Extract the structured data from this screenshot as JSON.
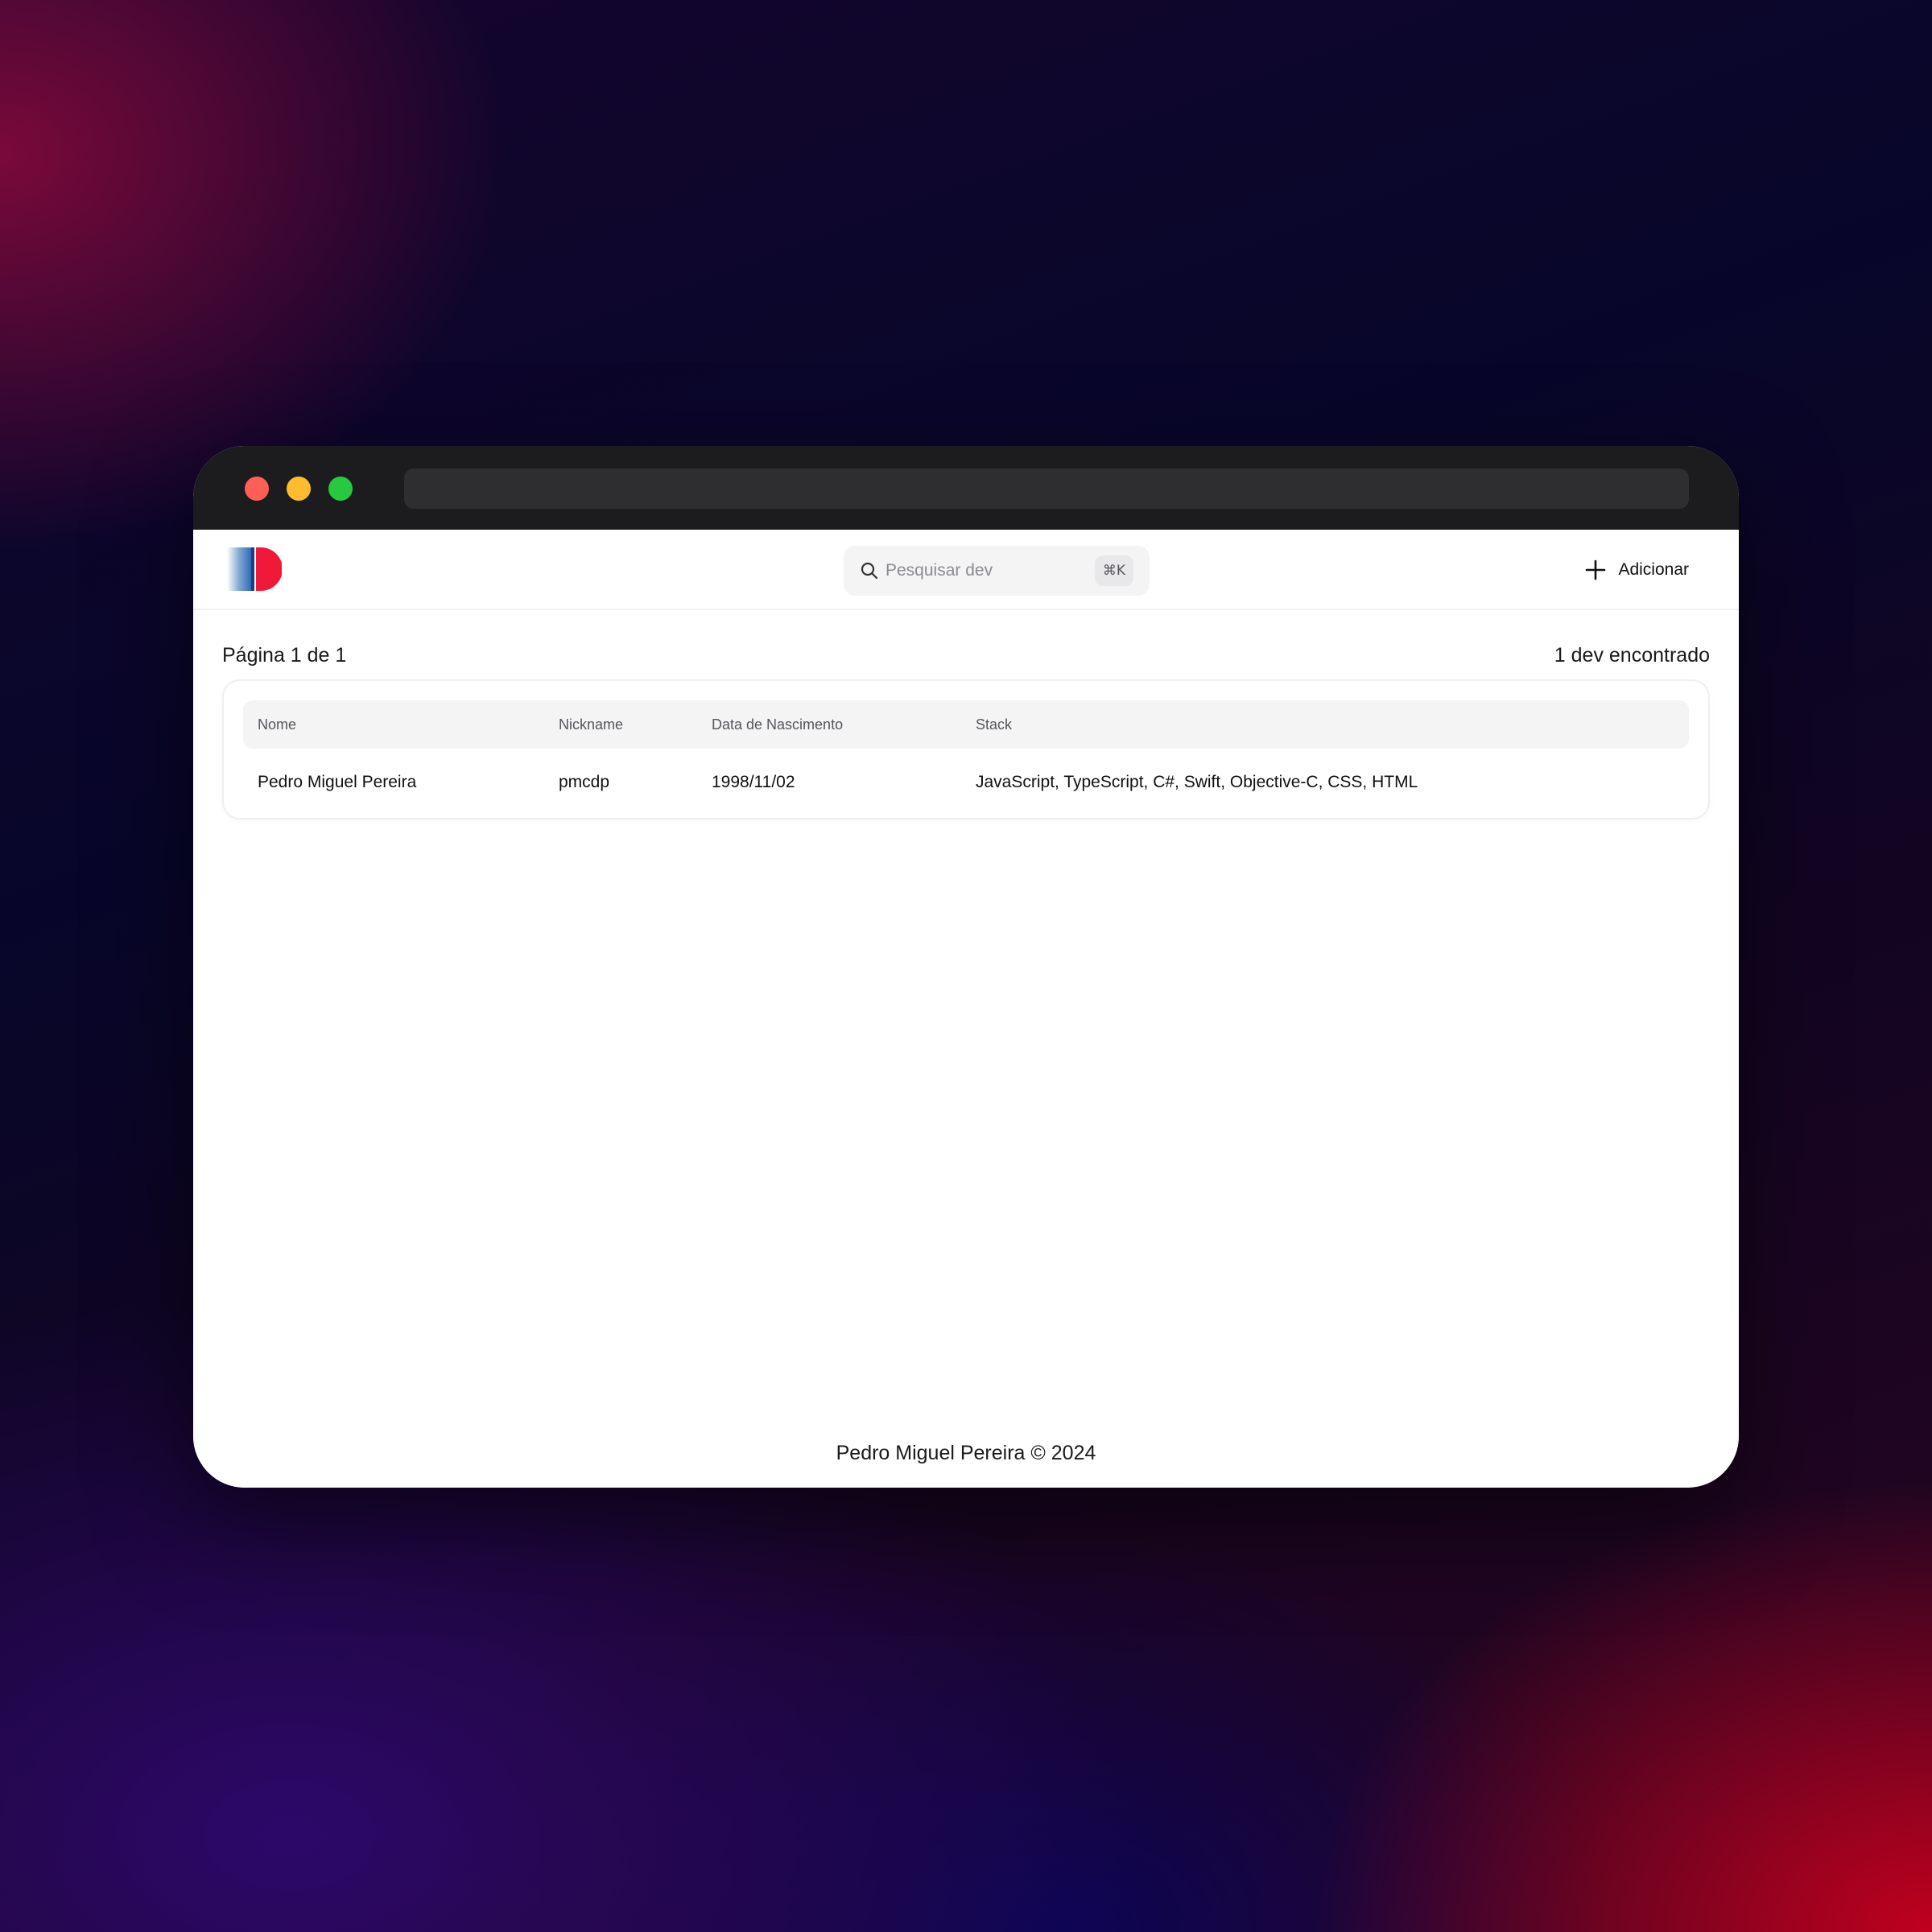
{
  "search": {
    "placeholder": "Pesquisar dev",
    "shortcut": "⌘K"
  },
  "toolbar": {
    "add_label": "Adicionar"
  },
  "pagination": {
    "label": "Página 1 de 1"
  },
  "results": {
    "count_label": "1 dev encontrado"
  },
  "table": {
    "headers": [
      "Nome",
      "Nickname",
      "Data de Nascimento",
      "Stack"
    ],
    "rows": [
      [
        "Pedro Miguel Pereira",
        "pmcdp",
        "1998/11/02",
        "JavaScript, TypeScript, C#, Swift, Objective-C, CSS, HTML"
      ]
    ]
  },
  "footer": {
    "text": "Pedro Miguel Pereira © 2024"
  },
  "icons": {
    "search": "search-icon",
    "add": "plus-icon",
    "logo": "logo-icon"
  },
  "colors": {
    "accent": "#f0193a",
    "logo_blue": "#2f6db5",
    "titlebar": "#1c1c1e"
  }
}
